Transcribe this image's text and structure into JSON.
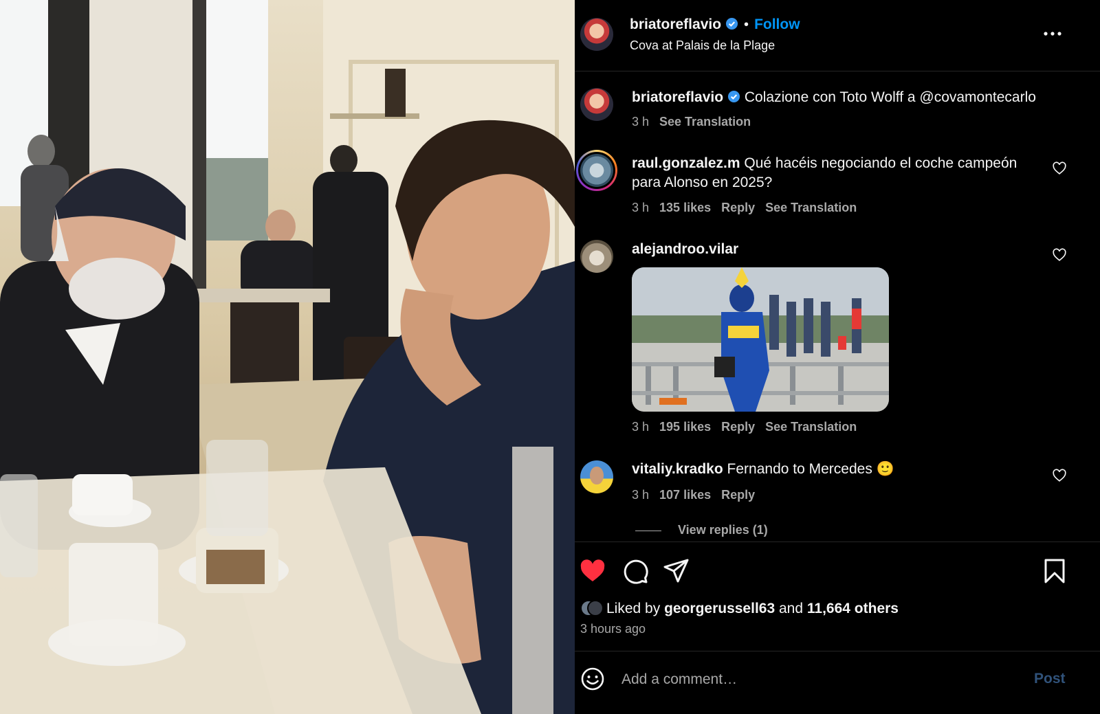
{
  "post": {
    "owner_username": "briatoreflavio",
    "follow_label": "Follow",
    "separator": "•",
    "location": "Cova at Palais de la Plage"
  },
  "caption": {
    "username": "briatoreflavio",
    "text": "Colazione con Toto Wolff a @covamontecarlo",
    "time": "3 h",
    "translate": "See Translation"
  },
  "comments": [
    {
      "username": "raul.gonzalez.m",
      "text": "Qué hacéis negociando el coche campeón para Alonso en 2025?",
      "time": "3 h",
      "likes": "135 likes",
      "reply": "Reply",
      "translate": "See Translation"
    },
    {
      "username": "alejandroo.vilar",
      "text": "",
      "time": "3 h",
      "likes": "195 likes",
      "reply": "Reply",
      "translate": "See Translation"
    },
    {
      "username": "vitaliy.kradko",
      "text": "Fernando to Mercedes 🙂",
      "time": "3 h",
      "likes": "107 likes",
      "reply": "Reply",
      "view_replies": "View replies (1)"
    }
  ],
  "likes": {
    "prefix": "Liked by",
    "user": "georgerussell63",
    "middle": "and",
    "others": "11,664 others",
    "time_ago": "3 hours ago"
  },
  "comment_box": {
    "placeholder": "Add a comment…",
    "post_label": "Post"
  },
  "colors": {
    "accent": "#0095f6",
    "like_red": "#ff3040",
    "muted": "#a8a8a8"
  },
  "icons": [
    "verified-icon",
    "more-icon",
    "heart-icon",
    "comment-icon",
    "share-icon",
    "bookmark-icon",
    "emoji-icon"
  ]
}
